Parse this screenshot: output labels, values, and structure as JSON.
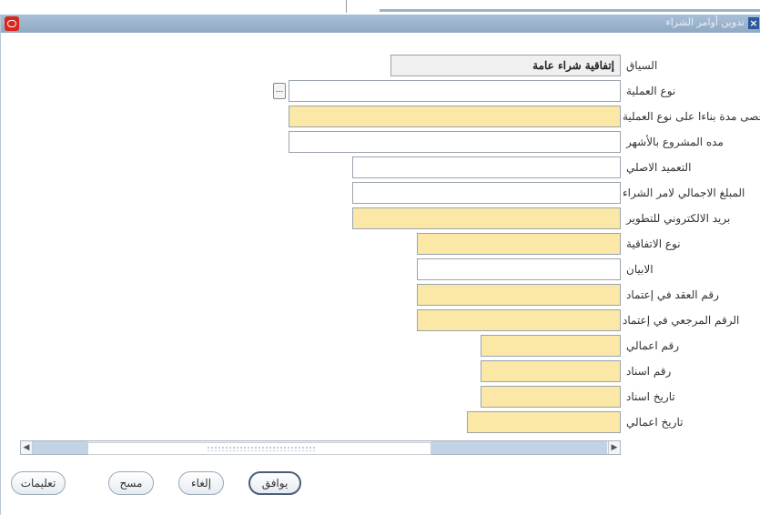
{
  "window": {
    "title": "تدوين أوامر الشراء"
  },
  "form": {
    "context": {
      "label": "السياق",
      "value": "إتفاقية شراء عامة"
    },
    "fields": [
      {
        "label": "نوع العملية",
        "value": ""
      },
      {
        "label": "أقصى مدة بناءا على نوع العملية",
        "value": ""
      },
      {
        "label": "مده المشروع بالأشهر",
        "value": ""
      },
      {
        "label": "التعميد الاصلي",
        "value": ""
      },
      {
        "label": "المبلغ الاجمالي لامر الشراء",
        "value": ""
      },
      {
        "label": "بريد الالكتروني للتطوير",
        "value": ""
      },
      {
        "label": "نوع الاتفاقية",
        "value": ""
      },
      {
        "label": "الابيان",
        "value": ""
      },
      {
        "label": "رقم العقد في إعتماد",
        "value": ""
      },
      {
        "label": "الرقم المرجعي في إعتماد",
        "value": ""
      },
      {
        "label": "رقم اعمالي",
        "value": ""
      },
      {
        "label": "رقم اسناد",
        "value": ""
      },
      {
        "label": "تاريخ اسناد",
        "value": ""
      },
      {
        "label": "تاريخ اعمالي",
        "value": ""
      }
    ],
    "lov_button_label": "..."
  },
  "buttons": {
    "ok": "يوافق",
    "cancel": "إلغاء",
    "clear": "مسح",
    "help": "تعليمات"
  }
}
